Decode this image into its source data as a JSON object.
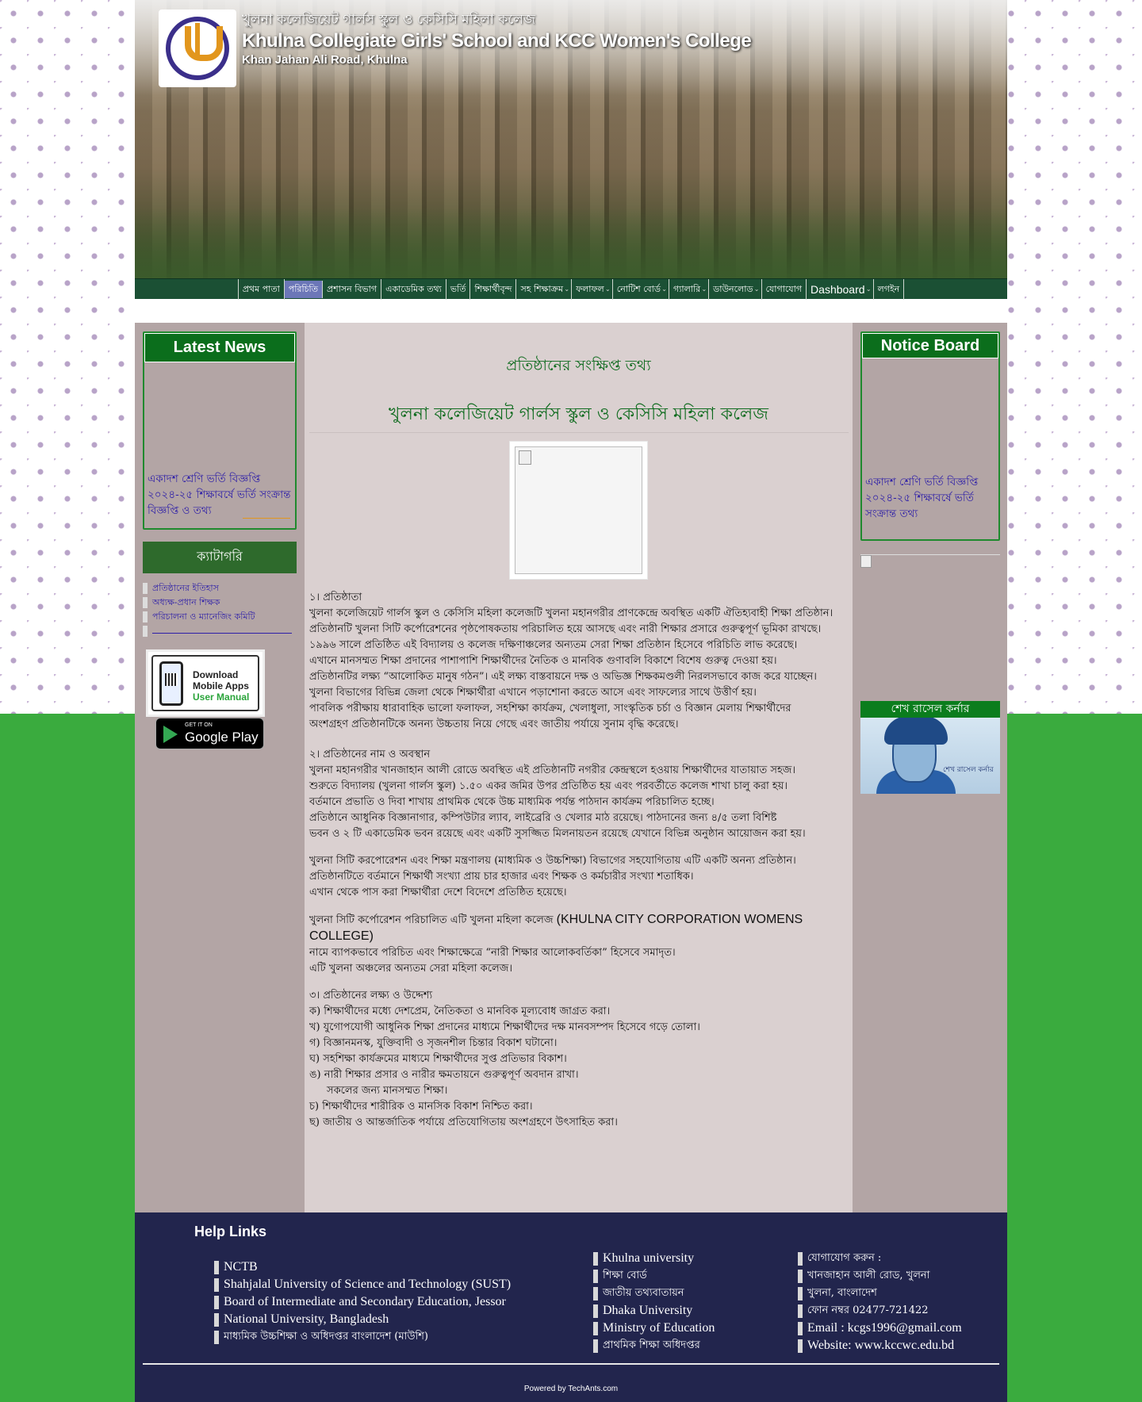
{
  "header": {
    "title_bn": "খুলনা কলেজিয়েট গার্লস স্কুল ও কেসিসি মহিলা কলেজ",
    "title_en": "Khulna Collegiate Girls' School and KCC Women's College",
    "address": "Khan Jahan Ali Road, Khulna"
  },
  "nav": {
    "items": [
      {
        "label": "প্রথম পাতা",
        "dropdown": false,
        "active": false
      },
      {
        "label": "পরিচিতি",
        "dropdown": false,
        "active": true
      },
      {
        "label": "প্রশাসন বিভাগ",
        "dropdown": false,
        "active": false
      },
      {
        "label": "একাডেমিক তথ্য",
        "dropdown": false,
        "active": false
      },
      {
        "label": "ভর্তি",
        "dropdown": false,
        "active": false
      },
      {
        "label": "শিক্ষার্থীবৃন্দ",
        "dropdown": false,
        "active": false
      },
      {
        "label": "সহ শিক্ষাক্রম",
        "dropdown": true,
        "active": false
      },
      {
        "label": "ফলাফল",
        "dropdown": true,
        "active": false
      },
      {
        "label": "নোটিশ বোর্ড",
        "dropdown": true,
        "active": false
      },
      {
        "label": "গ্যালারি",
        "dropdown": true,
        "active": false
      },
      {
        "label": "ডাউনলোড",
        "dropdown": true,
        "active": false
      },
      {
        "label": "যোগাযোগ",
        "dropdown": false,
        "active": false
      },
      {
        "label": "Dashboard",
        "dropdown": true,
        "active": false
      },
      {
        "label": "লগইন",
        "dropdown": false,
        "active": false
      }
    ]
  },
  "left": {
    "news_title": "Latest News",
    "news_lines": [
      "একাদশ শ্রেণি ভর্তি বিজ্ঞপ্তি",
      "২০২৪-২৫ শিক্ষাবর্ষে ভর্তি সংক্রান্ত",
      "বিজ্ঞপ্তি ও তথ্য"
    ],
    "categories_title": "ক্যাটাগরি",
    "categories": [
      "প্রতিষ্ঠানের ইতিহাস",
      "অধ্যক্ষ-প্রধান শিক্ষক",
      "পরিচালনা ও ম্যানেজিং কমিটি"
    ],
    "app": {
      "line1": "Download",
      "line2": "Mobile Apps",
      "line3": "User Manual"
    },
    "gplay": {
      "small": "GET IT ON",
      "big": "Google Play"
    }
  },
  "right": {
    "notice_title": "Notice Board",
    "notice_lines": [
      "একাদশ শ্রেণি ভর্তি বিজ্ঞপ্তি",
      "২০২৪-২৫ শিক্ষাবর্ষে ভর্তি",
      "সংক্রান্ত তথ্য"
    ],
    "hero_title": "শেখ রাসেল কর্নার",
    "hero_caption": "শেখ রাসেল কর্নার"
  },
  "content": {
    "category": "প্রতিষ্ঠানের সংক্ষিপ্ত তথ্য",
    "title": "খুলনা কলেজিয়েট গার্লস স্কুল ও কেসিসি মহিলা কলেজ",
    "sec1_head": "১। প্রতিষ্ঠাতা",
    "sec1_lines": [
      "খুলনা কলেজিয়েট গার্লস স্কুল ও কেসিসি মহিলা কলেজটি খুলনা মহানগরীর প্রাণকেন্দ্রে অবস্থিত একটি ঐতিহ্যবাহী শিক্ষা প্রতিষ্ঠান।",
      "প্রতিষ্ঠানটি খুলনা সিটি কর্পোরেশনের পৃষ্ঠপোষকতায় পরিচালিত হয়ে আসছে এবং নারী শিক্ষার প্রসারে গুরুত্বপূর্ণ ভূমিকা রাখছে।",
      "১৯৯৬ সালে প্রতিষ্ঠিত এই বিদ্যালয় ও কলেজ দক্ষিণাঞ্চলের অন্যতম সেরা শিক্ষা প্রতিষ্ঠান হিসেবে পরিচিতি লাভ করেছে।",
      "এখানে মানসম্মত শিক্ষা প্রদানের পাশাপাশি শিক্ষার্থীদের নৈতিক ও মানবিক গুণাবলি বিকাশে বিশেষ গুরুত্ব দেওয়া হয়।",
      "প্রতিষ্ঠানটির লক্ষ্য “আলোকিত মানুষ গঠন”। এই লক্ষ্য বাস্তবায়নে দক্ষ ও অভিজ্ঞ শিক্ষকমণ্ডলী নিরলসভাবে কাজ করে যাচ্ছেন।",
      "খুলনা বিভাগের বিভিন্ন জেলা থেকে শিক্ষার্থীরা এখানে পড়াশোনা করতে আসে এবং সাফল্যের সাথে উত্তীর্ণ হয়।",
      "পাবলিক পরীক্ষায় ধারাবাহিক ভালো ফলাফল, সহশিক্ষা কার্যক্রম, খেলাধুলা, সাংস্কৃতিক চর্চা ও বিজ্ঞান মেলায় শিক্ষার্থীদের",
      "অংশগ্রহণ প্রতিষ্ঠানটিকে অনন্য উচ্চতায় নিয়ে গেছে এবং জাতীয় পর্যায়ে সুনাম বৃদ্ধি করেছে।"
    ],
    "sec2_head": "২। প্রতিষ্ঠানের নাম ও অবস্থান",
    "sec2_lines": [
      "খুলনা মহানগরীর খানজাহান আলী রোডে অবস্থিত এই প্রতিষ্ঠানটি নগরীর কেন্দ্রস্থলে হওয়ায় শিক্ষার্থীদের যাতায়াত সহজ।",
      "শুরুতে বিদ্যালয় (খুলনা গার্লস স্কুল) ১.৫০ একর জমির উপর প্রতিষ্ঠিত হয় এবং পরবর্তীতে কলেজ শাখা চালু করা হয়।",
      "বর্তমানে প্রভাতি ও দিবা শাখায় প্রাথমিক থেকে উচ্চ মাধ্যমিক পর্যন্ত পাঠদান কার্যক্রম পরিচালিত হচ্ছে।",
      "প্রতিষ্ঠানে আধুনিক বিজ্ঞানাগার, কম্পিউটার ল্যাব, লাইব্রেরি ও খেলার মাঠ রয়েছে। পাঠদানের জন্য ৪/৫ তলা বিশিষ্ট",
      "ভবন ও ২ টি একাডেমিক ভবন রয়েছে এবং একটি সুসজ্জিত মিলনায়তন রয়েছে যেখানে বিভিন্ন অনুষ্ঠান আয়োজন করা হয়।"
    ],
    "sec3_lines": [
      "খুলনা সিটি করপোরেশন এবং শিক্ষা মন্ত্রণালয় (মাধ্যমিক ও উচ্চশিক্ষা) বিভাগের সহযোগিতায় এটি একটি অনন্য প্রতিষ্ঠান।",
      "প্রতিষ্ঠানটিতে বর্তমানে শিক্ষার্থী সংখ্যা প্রায় চার হাজার এবং শিক্ষক ও কর্মচারীর সংখ্যা শতাধিক।",
      "এখান থেকে পাস করা শিক্ষার্থীরা দেশে বিদেশে প্রতিষ্ঠিত হয়েছে।"
    ],
    "sec4_lead_bn": "খুলনা সিটি কর্পোরেশন পরিচালিত এটি খুলনা মহিলা কলেজ",
    "sec4_lead_en": "(KHULNA CITY CORPORATION WOMENS COLLEGE)",
    "sec4_lines": [
      "নামে ব্যাপকভাবে পরিচিত এবং শিক্ষাক্ষেত্রে “নারী শিক্ষার আলোকবর্তিকা” হিসেবে সমাদৃত।",
      "এটি খুলনা অঞ্চলের অন্যতম সেরা মহিলা কলেজ।"
    ],
    "sec5_head": "৩। প্রতিষ্ঠানের লক্ষ্য ও উদ্দেশ্য",
    "sec5_lines": [
      "ক) শিক্ষার্থীদের মধ্যে দেশপ্রেম, নৈতিকতা ও মানবিক মূল্যবোধ জাগ্রত করা।",
      "খ) যুগোপযোগী আধুনিক শিক্ষা প্রদানের মাধ্যমে শিক্ষার্থীদের দক্ষ মানবসম্পদ হিসেবে গড়ে তোলা।",
      "গ) বিজ্ঞানমনস্ক, যুক্তিবাদী ও সৃজনশীল চিন্তার বিকাশ ঘটানো।",
      "ঘ) সহশিক্ষা কার্যক্রমের মাধ্যমে শিক্ষার্থীদের সুপ্ত প্রতিভার বিকাশ।",
      "ঙ) নারী শিক্ষার প্রসার ও নারীর ক্ষমতায়নে গুরুত্বপূর্ণ অবদান রাখা।",
      "সকলের জন্য মানসম্মত শিক্ষা।",
      "চ) শিক্ষার্থীদের শারীরিক ও মানসিক বিকাশ নিশ্চিত করা।",
      "ছ) জাতীয় ও আন্তর্জাতিক পর্যায়ে প্রতিযোগিতায় অংশগ্রহণে উৎসাহিত করা।"
    ]
  },
  "footer": {
    "head": "Help Links",
    "col1": [
      "NCTB",
      "Shahjalal University of Science and Technology (SUST)",
      "Board of Intermediate and Secondary Education, Jessor",
      "National University, Bangladesh",
      "মাধ্যমিক উচ্চশিক্ষা ও অধিদপ্তর বাংলাদেশ (মাউশি)"
    ],
    "col2": [
      "Khulna university",
      "শিক্ষা বোর্ড",
      "জাতীয় তথ্যবাতায়ন",
      "Dhaka University",
      "Ministry of Education",
      "প্রাথমিক শিক্ষা অধিদপ্তর"
    ],
    "col3": [
      "যোগাযোগ করুন :",
      "খানজাহান আলী রোড, খুলনা",
      "খুলনা, বাংলাদেশ",
      "ফোন নম্বর 02477-721422",
      "Email : kcgs1996@gmail.com",
      "Website: www.kccwc.edu.bd"
    ],
    "powered": "Powered by TechAnts.com"
  }
}
